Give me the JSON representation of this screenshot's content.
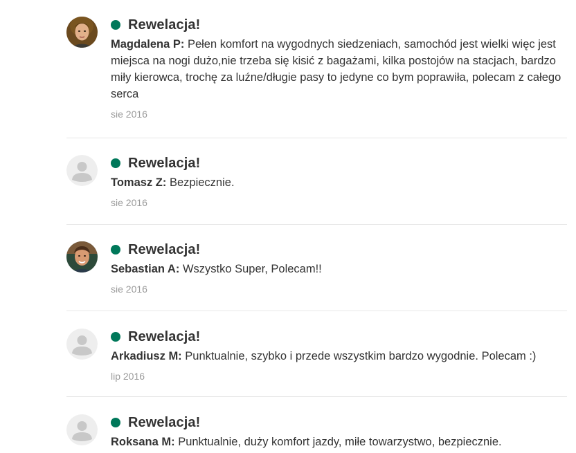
{
  "colors": {
    "rating_dot": "#00785a",
    "text": "#333333",
    "date": "#9a9a9a",
    "divider": "#e6e6e6"
  },
  "reviews": [
    {
      "avatar": "photo-woman-avatar",
      "rating": "Rewelacja!",
      "author": "Magdalena P:",
      "text": "Pełen komfort na wygodnych siedzeniach, samochód jest wielki więc jest miejsca na nogi dużo,nie trzeba się kisić z bagażami, kilka postojów na stacjach, bardzo miły kierowca, trochę za luźne/długie pasy to jedyne co bym poprawiła, polecam z całego serca",
      "date": "sie 2016"
    },
    {
      "avatar": "default-user-avatar",
      "rating": "Rewelacja!",
      "author": "Tomasz Z:",
      "text": "Bezpiecznie.",
      "date": "sie 2016"
    },
    {
      "avatar": "photo-man-avatar",
      "rating": "Rewelacja!",
      "author": "Sebastian A:",
      "text": "Wszystko Super, Polecam!!",
      "date": "sie 2016"
    },
    {
      "avatar": "default-user-avatar",
      "rating": "Rewelacja!",
      "author": "Arkadiusz M:",
      "text": "Punktualnie, szybko i przede wszystkim bardzo wygodnie. Polecam :)",
      "date": "lip 2016"
    },
    {
      "avatar": "default-user-avatar",
      "rating": "Rewelacja!",
      "author": "Roksana M:",
      "text": "Punktualnie, duży komfort jazdy, miłe towarzystwo, bezpiecznie.",
      "date": ""
    }
  ]
}
